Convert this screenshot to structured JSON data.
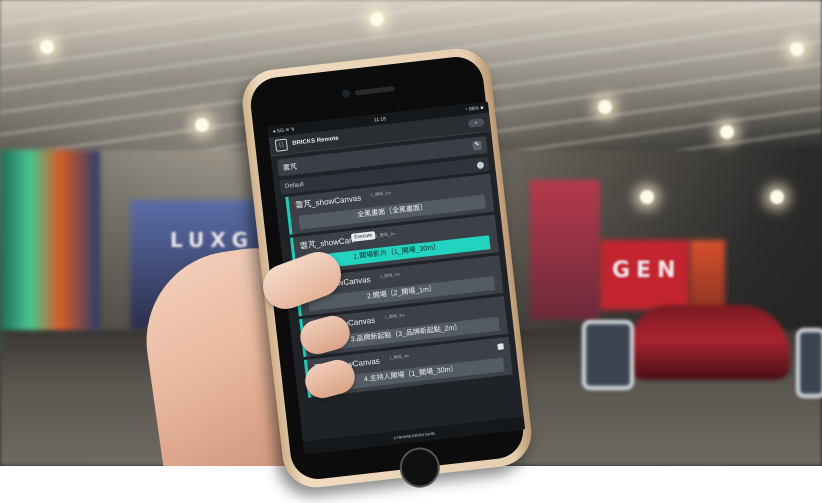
{
  "status_bar": {
    "left": "● 5G ≋ ↯",
    "time": "11:18",
    "right": "◔ 86% ■"
  },
  "app": {
    "title": "BRICKS Remote",
    "logo": "[ ]",
    "menu": "≡"
  },
  "project": {
    "name": "雲芃",
    "edit_icon": "✎"
  },
  "group": {
    "name": "Default"
  },
  "tooltip": "Execute",
  "cards": [
    {
      "name": "雲芃_showCanvas",
      "sub": "1_開場_3m",
      "scene": "全黑畫面〔全黑畫面〕",
      "active": false
    },
    {
      "name": "雲芃_showCan",
      "sub": "1_開場_3m",
      "scene": "1.開場影片〔1_開場_30m〕",
      "active": true
    },
    {
      "name": "雲芃_showCanvas",
      "sub": "1_開場_3m",
      "scene": "2.開場〔2_開場_1m〕",
      "active": false
    },
    {
      "name": "雲芃_showCanvas",
      "sub": "1_開場_3m",
      "scene": "3.品牌新起點〔3_品牌新起點_2m〕",
      "active": false
    },
    {
      "name": "雲芃_showCanvas",
      "sub": "1_開場_3m",
      "scene": "4.主持人開場〔1_開場_30m〕",
      "active": false
    }
  ],
  "footer": "s-remote.bricks.tools",
  "background": {
    "brand_left": "LUXG",
    "brand_right": "GEN"
  },
  "colors": {
    "accent": "#22d3bf",
    "car": "#a82430"
  }
}
